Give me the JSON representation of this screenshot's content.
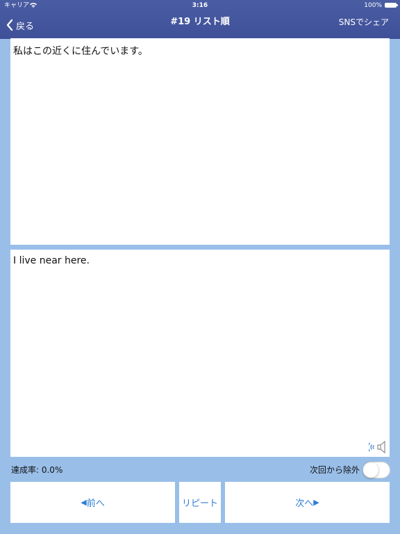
{
  "status_bar": {
    "carrier": "キャリア",
    "time": "3:16",
    "battery": "100%"
  },
  "nav": {
    "back_label": "戻る",
    "title": "#19 リスト順",
    "share_label": "SNSでシェア"
  },
  "cards": {
    "japanese": "私はこの近くに住んでいます。",
    "english": "I live near here."
  },
  "footer": {
    "progress": "達成率: 0.0%",
    "exclude_label": "次回から除外",
    "exclude_on": false
  },
  "buttons": {
    "prev_arrow": "◀",
    "prev_label": "前へ",
    "repeat_label": "リピート",
    "next_label": "次へ",
    "next_arrow": "▶"
  },
  "colors": {
    "nav_bar": "#4a5da3",
    "background": "#99bfe9",
    "accent": "#2e7dd6"
  }
}
